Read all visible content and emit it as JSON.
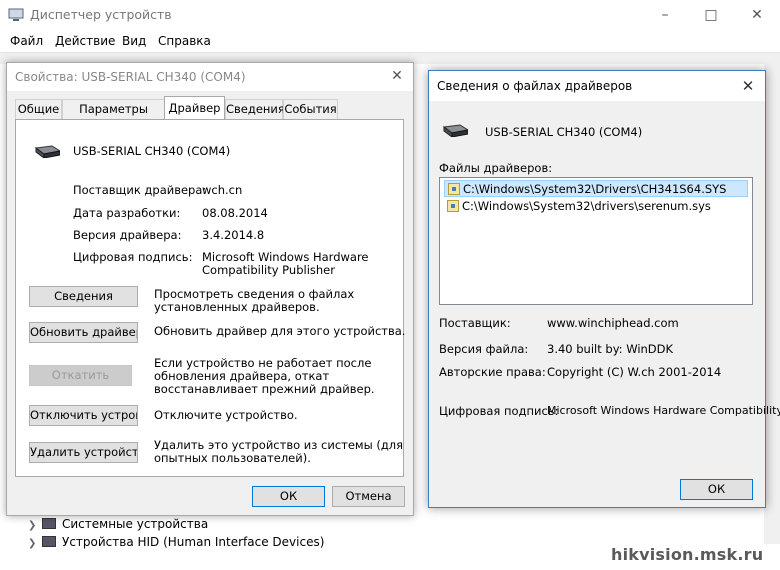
{
  "main_window": {
    "title": "Диспетчер устройств",
    "menu": [
      "Файл",
      "Действие",
      "Вид",
      "Справка"
    ],
    "tree_items": [
      "Системные устройства",
      "Устройства HID (Human Interface Devices)"
    ]
  },
  "properties_dialog": {
    "title": "Свойства: USB-SERIAL CH340 (COM4)",
    "tabs": [
      "Общие",
      "Параметры порта",
      "Драйвер",
      "Сведения",
      "События"
    ],
    "active_tab": "Драйвер",
    "device_name": "USB-SERIAL CH340 (COM4)",
    "info": {
      "provider_label": "Поставщик драйвера:",
      "provider_value": "wch.cn",
      "date_label": "Дата разработки:",
      "date_value": "08.08.2014",
      "version_label": "Версия драйвера:",
      "version_value": "3.4.2014.8",
      "signer_label": "Цифровая подпись:",
      "signer_value_line1": "Microsoft Windows Hardware",
      "signer_value_line2": "Compatibility Publisher"
    },
    "actions": [
      {
        "button": "Сведения",
        "desc1": "Просмотреть сведения о файлах",
        "desc2": "установленных драйверов.",
        "desc3": ""
      },
      {
        "button": "Обновить драйвер",
        "desc1": "Обновить драйвер для этого устройства.",
        "desc2": "",
        "desc3": ""
      },
      {
        "button": "Откатить",
        "desc1": "Если устройство не работает после",
        "desc2": "обновления драйвера, откат",
        "desc3": "восстанавливает прежний драйвер."
      },
      {
        "button": "Отключить устройство",
        "desc1": "Отключите устройство.",
        "desc2": "",
        "desc3": ""
      },
      {
        "button": "Удалить устройство",
        "desc1": "Удалить это устройство из системы (для",
        "desc2": "опытных пользователей).",
        "desc3": ""
      }
    ],
    "ok": "ОК",
    "cancel": "Отмена"
  },
  "driver_files_dialog": {
    "title": "Сведения о файлах драйверов",
    "device_name": "USB-SERIAL CH340 (COM4)",
    "files_label": "Файлы драйверов:",
    "files": [
      "C:\\Windows\\System32\\Drivers\\CH341S64.SYS",
      "C:\\Windows\\System32\\drivers\\serenum.sys"
    ],
    "provider_label": "Поставщик:",
    "provider_value": "www.winchiphead.com",
    "file_version_label": "Версия файла:",
    "file_version_value": "3.40 built by: WinDDK",
    "copyright_label": "Авторские права:",
    "copyright_value": "Copyright (C) W.ch 2001-2014",
    "signer_label": "Цифровая подпись:",
    "signer_value": "Microsoft Windows Hardware Compatibility",
    "ok": "ОК"
  },
  "watermark": "hikvision.msk.ru"
}
